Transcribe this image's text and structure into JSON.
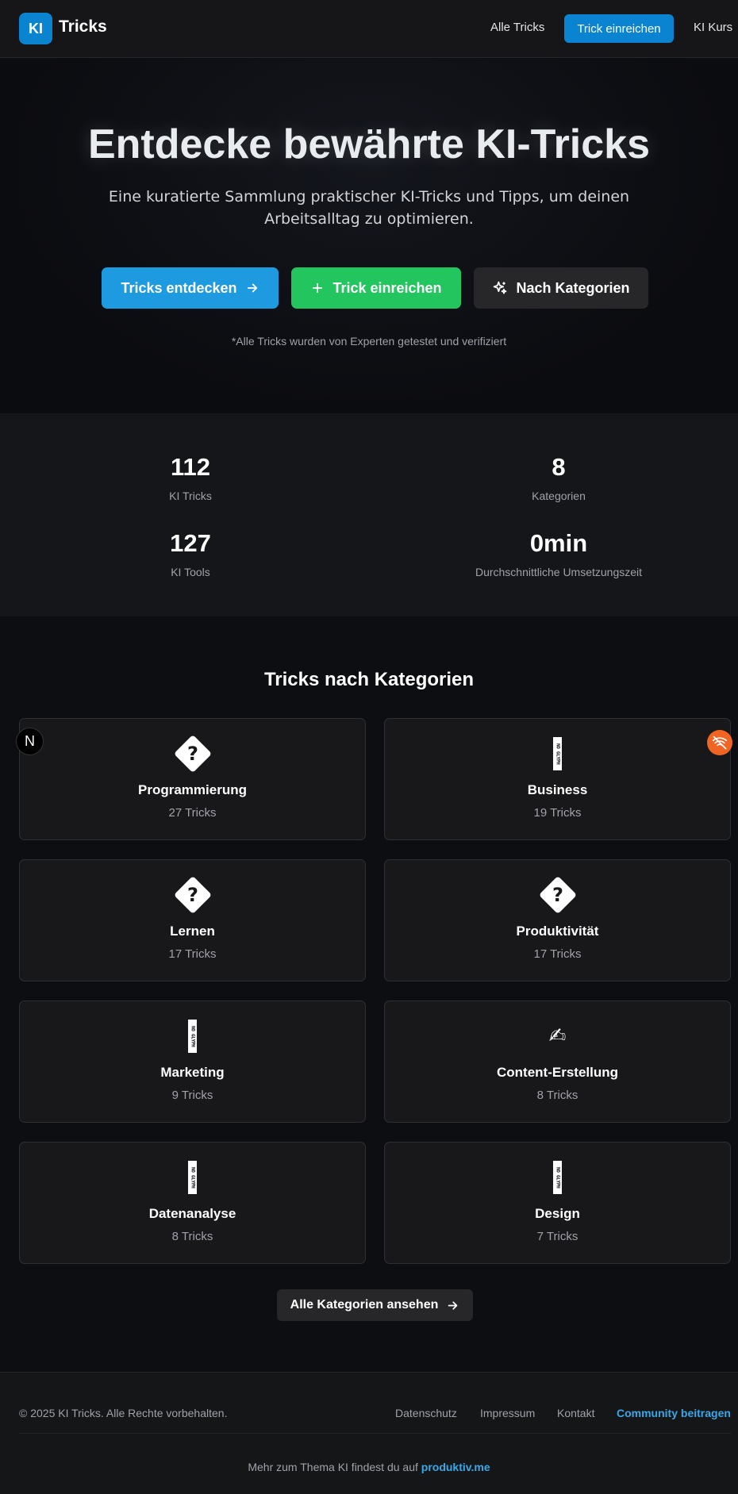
{
  "header": {
    "logo_badge": "KI",
    "logo_text": "Tricks",
    "nav": {
      "all_tricks": "Alle Tricks",
      "submit": "Trick einreichen",
      "course": "KI Kurs"
    }
  },
  "hero": {
    "title": "Entdecke bewährte KI-Tricks",
    "subtitle": "Eine kuratierte Sammlung praktischer KI-Tricks und Tipps, um deinen Arbeitsalltag zu optimieren.",
    "buttons": {
      "discover": "Tricks entdecken",
      "submit": "Trick einreichen",
      "categories": "Nach Kategorien"
    },
    "note": "*Alle Tricks wurden von Experten getestet und verifiziert"
  },
  "stats": [
    {
      "value": "112",
      "label": "KI Tricks"
    },
    {
      "value": "8",
      "label": "Kategorien"
    },
    {
      "value": "127",
      "label": "KI Tools"
    },
    {
      "value": "0min",
      "label": "Durchschnittliche Umsetzungszeit"
    }
  ],
  "categories": {
    "title": "Tricks nach Kategorien",
    "items": [
      {
        "name": "Programmierung",
        "count": "27 Tricks",
        "icon": "missing-glyph-icon"
      },
      {
        "name": "Business",
        "count": "19 Tricks",
        "icon": "no-glyph-icon"
      },
      {
        "name": "Lernen",
        "count": "17 Tricks",
        "icon": "missing-glyph-icon"
      },
      {
        "name": "Produktivität",
        "count": "17 Tricks",
        "icon": "missing-glyph-icon"
      },
      {
        "name": "Marketing",
        "count": "9 Tricks",
        "icon": "no-glyph-icon"
      },
      {
        "name": "Content-Erstellung",
        "count": "8 Tricks",
        "icon": "writing-hand-icon"
      },
      {
        "name": "Datenanalyse",
        "count": "8 Tricks",
        "icon": "no-glyph-icon"
      },
      {
        "name": "Design",
        "count": "7 Tricks",
        "icon": "no-glyph-icon"
      }
    ],
    "glyph_text": "NO GLYPH",
    "view_all": "Alle Kategorien ansehen"
  },
  "overlay": {
    "n_badge": "N"
  },
  "footer": {
    "copyright": "© 2025 KI Tricks. Alle Rechte vorbehalten.",
    "links": {
      "privacy": "Datenschutz",
      "imprint": "Impressum",
      "contact": "Kontakt",
      "community": "Community beitragen"
    },
    "more_prefix": "Mehr zum Thema KI findest du auf ",
    "more_link": "produktiv.me"
  },
  "colors": {
    "accent_blue": "#0a84d0",
    "hero_blue": "#1e9be0",
    "green": "#22c55e",
    "orange": "#f06523"
  }
}
